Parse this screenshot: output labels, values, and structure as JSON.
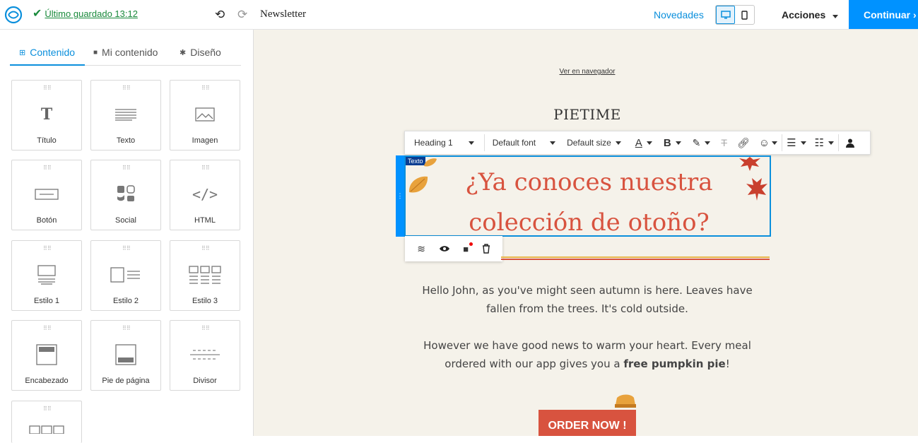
{
  "header": {
    "saved_label": "Último guardado 13:12",
    "doc_title": "Newsletter",
    "novedades": "Novedades",
    "acciones": "Acciones",
    "continuar": "Continuar"
  },
  "sidebar": {
    "tabs": [
      "Contenido",
      "Mi contenido",
      "Diseño"
    ],
    "blocks": [
      "Título",
      "Texto",
      "Imagen",
      "Botón",
      "Social",
      "HTML",
      "Estilo 1",
      "Estilo 2",
      "Estilo 3",
      "Encabezado",
      "Pie de página",
      "Divisor"
    ]
  },
  "canvas": {
    "ver_link": "Ver en navegador",
    "brand": "PIETIME",
    "toolbar": {
      "heading": "Heading 1",
      "font": "Default font",
      "size": "Default size"
    },
    "block_badge": "Texto",
    "heading_line1": "¿Ya conoces nuestra",
    "heading_line2": "colección de otoño?",
    "para1_line1": "Hello John, as you've might seen autumn is here. Leaves have",
    "para1_line2": "fallen from the trees. It's cold outside.",
    "para2_line1": "However we have good news to warm your heart. Every meal",
    "para2_line2_pre": "ordered with our app gives you a ",
    "para2_line2_bold": "free pumpkin pie",
    "para2_line2_post": "!",
    "order_button": "ORDER NOW !"
  },
  "colors": {
    "accent": "#0092ff",
    "heading": "#d8533f",
    "canvas_bg": "#f5f2ea"
  }
}
